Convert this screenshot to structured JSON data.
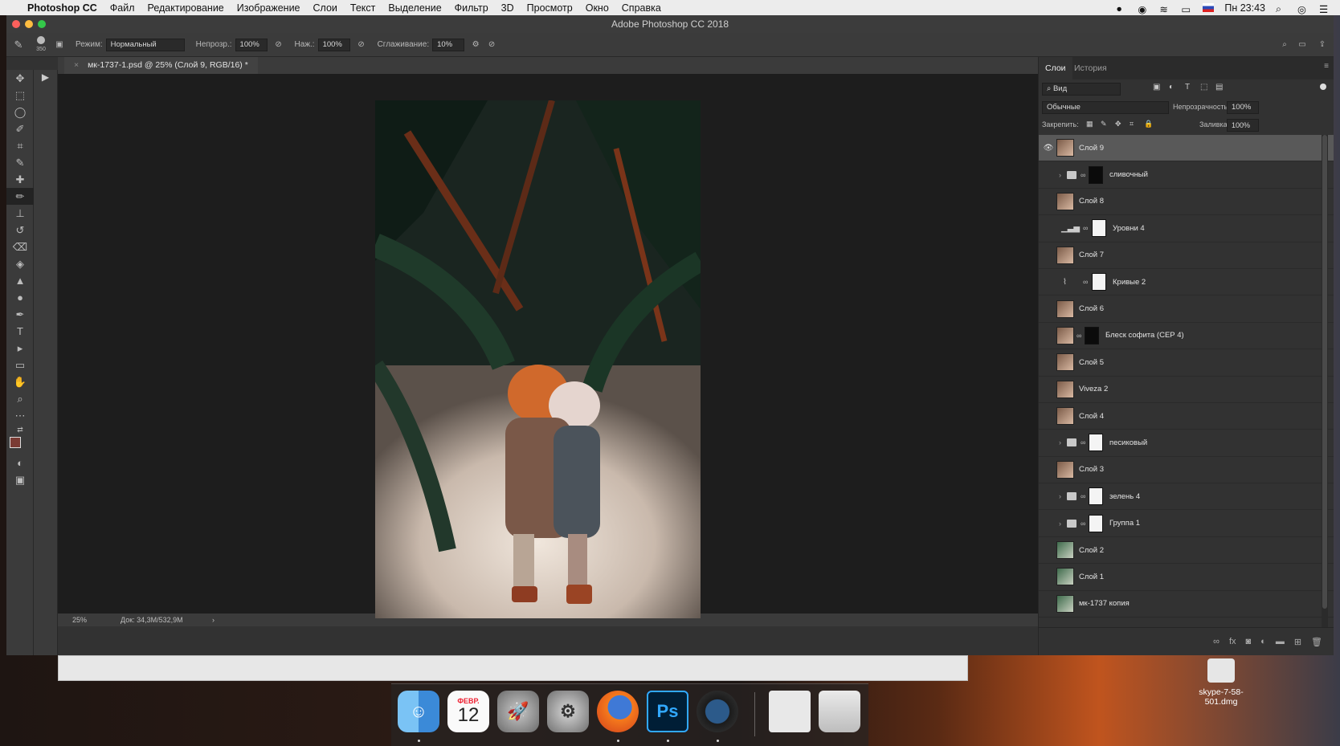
{
  "menubar": {
    "app_name": "Photoshop CC",
    "items": [
      "Файл",
      "Редактирование",
      "Изображение",
      "Слои",
      "Текст",
      "Выделение",
      "Фильтр",
      "3D",
      "Просмотр",
      "Окно",
      "Справка"
    ],
    "clock": "Пн 23:43"
  },
  "window": {
    "title": "Adobe Photoshop CC 2018"
  },
  "options": {
    "brush_size": "350",
    "mode_label": "Режим:",
    "mode_value": "Нормальный",
    "opacity_label": "Непрозр.:",
    "opacity_value": "100%",
    "pressure_label": "Наж.:",
    "pressure_value": "100%",
    "smoothing_label": "Сглаживание:",
    "smoothing_value": "10%"
  },
  "document": {
    "tab_title": "мк-1737-1.psd @ 25% (Слой 9, RGB/16) *",
    "zoom": "25%",
    "doc_info": "Док: 34,3M/532,9M"
  },
  "layers_panel": {
    "tab_layers": "Слои",
    "tab_history": "История",
    "filter_label": "Вид",
    "blend_mode": "Обычные",
    "opacity_label": "Непрозрачность:",
    "opacity_value": "100%",
    "lock_label": "Закрепить:",
    "fill_label": "Заливка:",
    "fill_value": "100%",
    "layers": [
      {
        "name": "Слой 9",
        "kind": "pixel",
        "selected": true,
        "visible": true
      },
      {
        "name": "сливочный",
        "kind": "group",
        "mask": "dark"
      },
      {
        "name": "Слой 8",
        "kind": "pixel"
      },
      {
        "name": "Уровни 4",
        "kind": "adjustment",
        "mask": "light"
      },
      {
        "name": "Слой 7",
        "kind": "pixel"
      },
      {
        "name": "Кривые 2",
        "kind": "adjustment",
        "mask": "light"
      },
      {
        "name": "Слой 6",
        "kind": "pixel"
      },
      {
        "name": "Блеск софита (СЕР 4)",
        "kind": "masked-pixel",
        "mask": "dark"
      },
      {
        "name": "Слой 5",
        "kind": "pixel"
      },
      {
        "name": "Viveza 2",
        "kind": "pixel"
      },
      {
        "name": "Слой 4",
        "kind": "pixel"
      },
      {
        "name": "песиковый",
        "kind": "group",
        "mask": "light"
      },
      {
        "name": "Слой 3",
        "kind": "pixel"
      },
      {
        "name": "зелень 4",
        "kind": "group",
        "mask": "light"
      },
      {
        "name": "Группа 1",
        "kind": "group",
        "mask": "light"
      },
      {
        "name": "Слой 2",
        "kind": "pixel"
      },
      {
        "name": "Слой 1",
        "kind": "pixel"
      },
      {
        "name": "мк-1737 копия",
        "kind": "pixel"
      }
    ]
  },
  "dock": {
    "calendar_month": "ФЕВР.",
    "calendar_day": "12",
    "photoshop_label": "Ps"
  },
  "desktop": {
    "file_label": "skype-7-58-501.dmg"
  }
}
